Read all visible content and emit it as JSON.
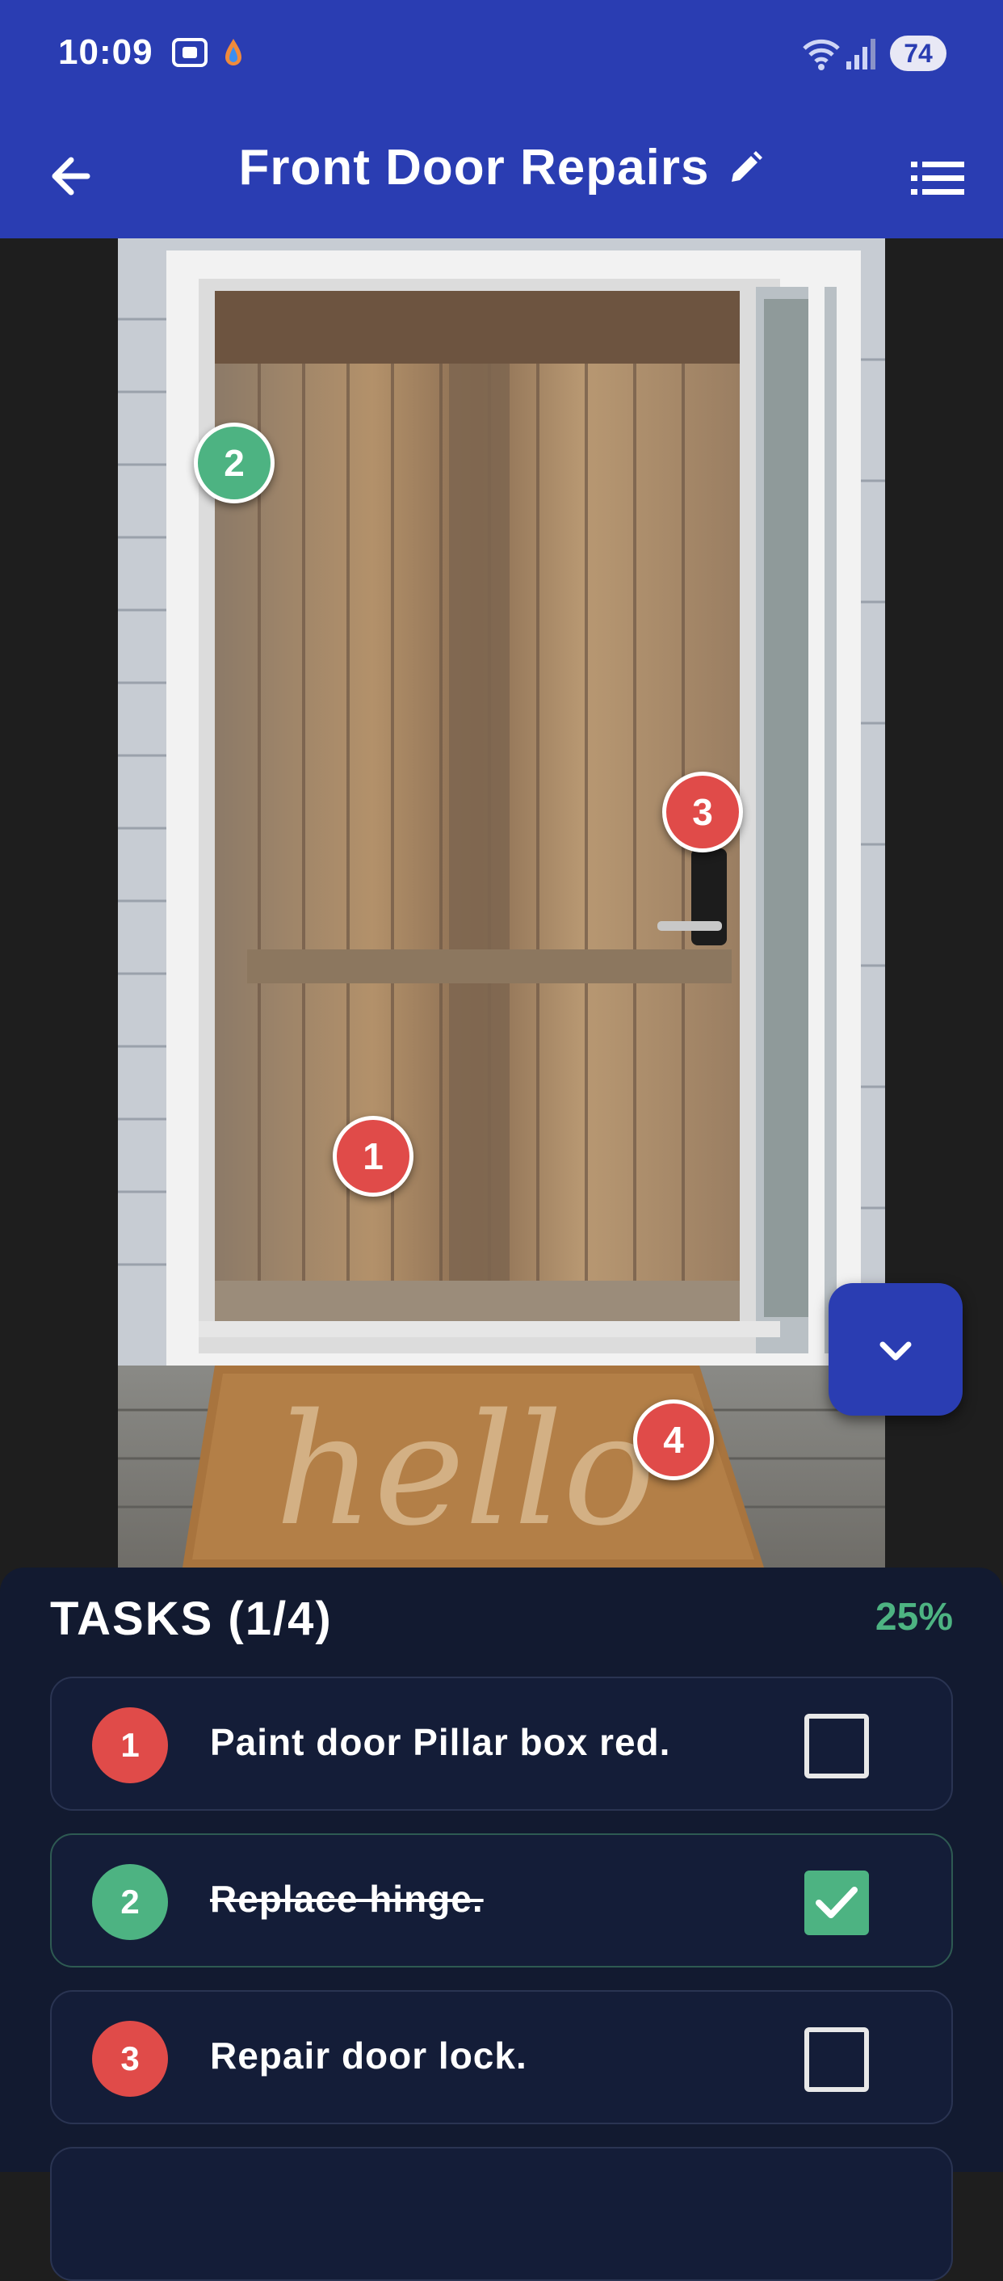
{
  "status_bar": {
    "time": "10:09",
    "battery": "74"
  },
  "app_bar": {
    "title": "Front Door Repairs"
  },
  "image": {
    "mat_text": "hello",
    "pins": [
      {
        "number": "2",
        "state": "done"
      },
      {
        "number": "3",
        "state": "open"
      },
      {
        "number": "1",
        "state": "open"
      },
      {
        "number": "4",
        "state": "open"
      }
    ]
  },
  "tasks": {
    "heading": "TASKS (1/4)",
    "percent": "25%",
    "items": [
      {
        "number": "1",
        "label": "Paint door Pillar box red.",
        "done": false
      },
      {
        "number": "2",
        "label": "Replace hinge.",
        "done": true
      },
      {
        "number": "3",
        "label": "Repair door lock.",
        "done": false
      }
    ]
  },
  "colors": {
    "primary": "#2a3db2",
    "open_pin": "#e04b49",
    "done_pin": "#4db382",
    "panel_bg": "#121a30",
    "percent": "#4db382"
  }
}
